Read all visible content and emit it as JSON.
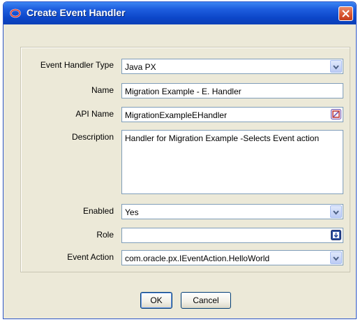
{
  "window": {
    "title": "Create Event Handler"
  },
  "form": {
    "event_handler_type": {
      "label": "Event Handler Type",
      "value": "Java PX"
    },
    "name": {
      "label": "Name",
      "value": "Migration Example - E. Handler"
    },
    "api_name": {
      "label": "API Name",
      "value": "MigrationExampleEHandler"
    },
    "description": {
      "label": "Description",
      "value": "Handler for Migration Example -Selects Event action"
    },
    "enabled": {
      "label": "Enabled",
      "value": "Yes"
    },
    "role": {
      "label": "Role",
      "value": ""
    },
    "event_action": {
      "label": "Event Action",
      "value": "com.oracle.px.IEventAction.HelloWorld"
    }
  },
  "buttons": {
    "ok": "OK",
    "cancel": "Cancel"
  },
  "colors": {
    "title_bar": "#0c46c9",
    "dialog_bg": "#ece9d8",
    "close_button": "#d8532f"
  },
  "icons": {
    "title": "oracle-logo-icon",
    "close": "close-icon",
    "api_name_action": "edit-icon",
    "role_action": "lookup-icon",
    "dropdown": "chevron-down-icon"
  }
}
